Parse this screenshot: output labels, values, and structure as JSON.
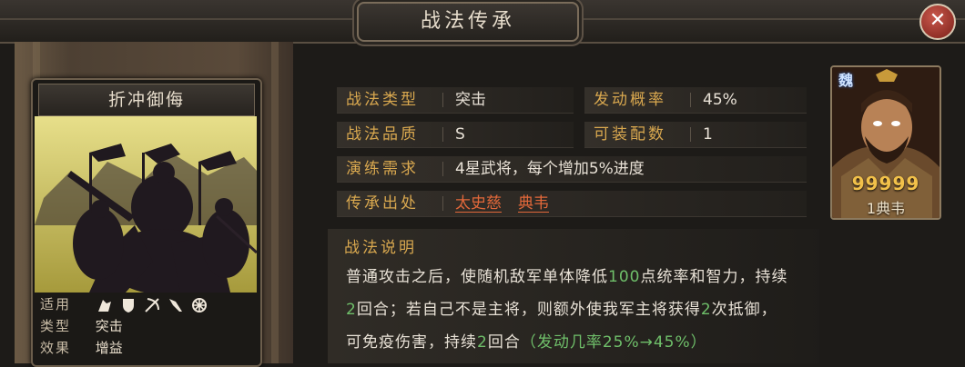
{
  "window": {
    "title": "战法传承",
    "close_icon": "close-x-icon"
  },
  "skill_card": {
    "name": "折冲御侮",
    "applicable_label": "适用",
    "applicable_icons": [
      "cavalry-icon",
      "shield-icon",
      "bow-icon",
      "spear-icon",
      "siege-icon"
    ],
    "type_label": "类型",
    "type_value": "突击",
    "effect_label": "效果",
    "effect_value": "增益"
  },
  "details": {
    "type_label": "战法类型",
    "type_value": "突击",
    "rate_label": "发动概率",
    "rate_value": "45%",
    "quality_label": "战法品质",
    "quality_value": "S",
    "slots_label": "可装配数",
    "slots_value": "1",
    "requirement_label": "演练需求",
    "requirement_value": "4星武将，每个增加5%进度",
    "source_label": "传承出处",
    "source_1": "太史慈",
    "source_2": "典韦"
  },
  "description": {
    "title": "战法说明",
    "line1": {
      "a": "普通攻击之后，使随机敌军单体降低",
      "b": "100",
      "c": "点统率和智力，持续"
    },
    "line2": {
      "a": "2",
      "b": "回合；若自己不是主将，则额外使我军主将获得",
      "c": "2",
      "d": "次抵御，"
    },
    "line3": {
      "a": "可免疫伤害，持续",
      "b": "2",
      "c": "回合",
      "d": "（发动几率25%→45%）"
    }
  },
  "general": {
    "kingdom": "魏",
    "stars": "99999",
    "name": "1典韦"
  },
  "colors": {
    "label_gold": "#d9a84f",
    "link_orange": "#e2683a",
    "highlight_green": "#6fbf6a"
  }
}
